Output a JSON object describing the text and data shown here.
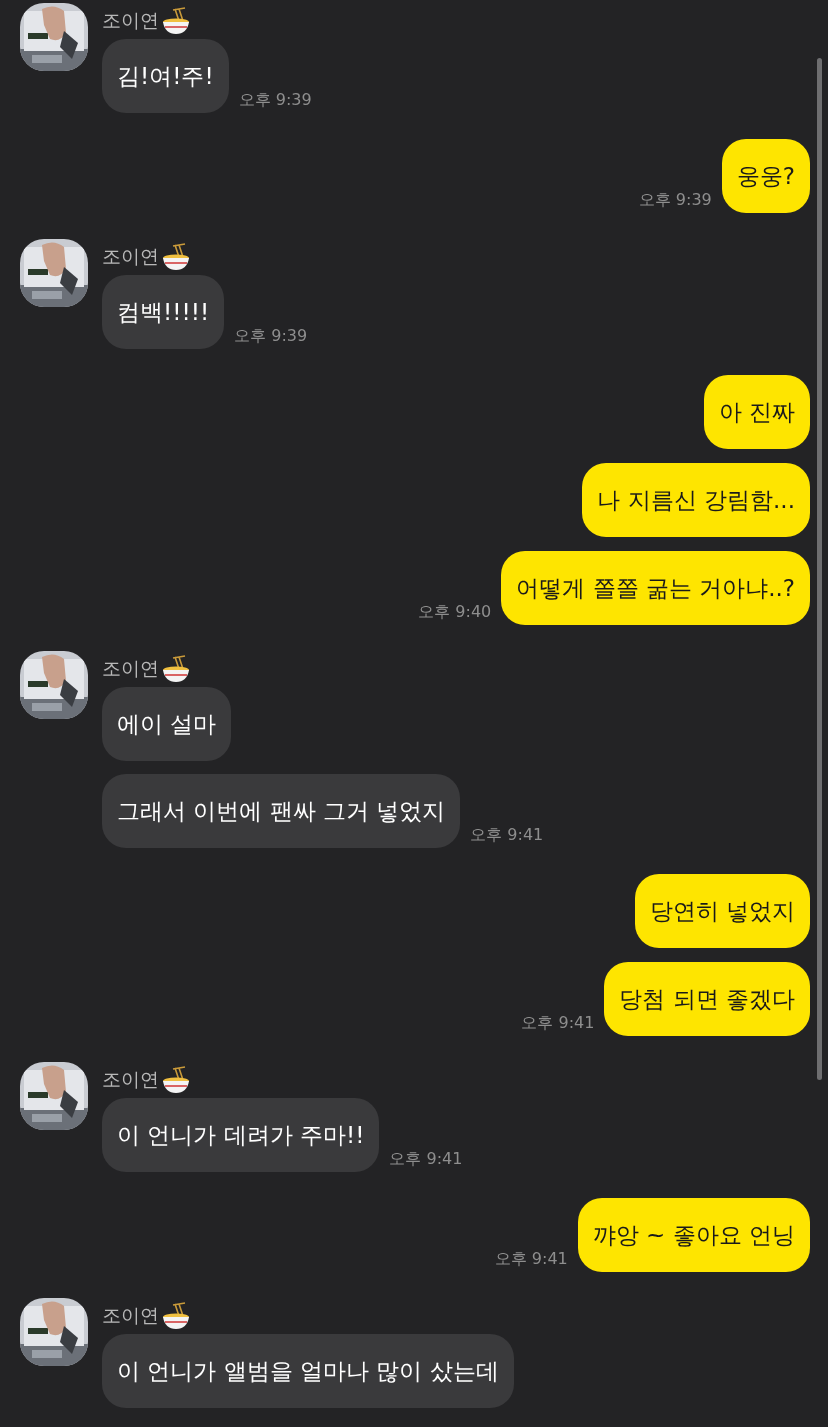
{
  "groups": [
    {
      "kind": "received",
      "sender": "조이연",
      "messages": [
        {
          "text": "김!여!주!",
          "time": "오후 9:39"
        }
      ]
    },
    {
      "kind": "sent",
      "messages": [
        {
          "text": "웅웅?",
          "time": "오후 9:39"
        }
      ]
    },
    {
      "kind": "received",
      "sender": "조이연",
      "messages": [
        {
          "text": "컴백!!!!!",
          "time": "오후 9:39"
        }
      ]
    },
    {
      "kind": "sent",
      "messages": [
        {
          "text": "아 진짜"
        },
        {
          "text": "나 지름신 강림함..."
        },
        {
          "text": "어떻게 쫄쫄 굶는 거아냐..?",
          "time": "오후 9:40"
        }
      ]
    },
    {
      "kind": "received",
      "sender": "조이연",
      "messages": [
        {
          "text": "에이 설마"
        },
        {
          "text": "그래서 이번에 팬싸 그거 넣었지",
          "time": "오후 9:41"
        }
      ]
    },
    {
      "kind": "sent",
      "messages": [
        {
          "text": "당연히 넣었지"
        },
        {
          "text": "당첨 되면 좋겠다",
          "time": "오후 9:41"
        }
      ]
    },
    {
      "kind": "received",
      "sender": "조이연",
      "messages": [
        {
          "text": "이 언니가 데려가 주마!!",
          "time": "오후 9:41"
        }
      ]
    },
    {
      "kind": "sent",
      "messages": [
        {
          "text": "꺄앙 ~ 좋아요 언닝",
          "time": "오후 9:41"
        }
      ]
    },
    {
      "kind": "received",
      "sender": "조이연",
      "messages": [
        {
          "text": "이 언니가 앨범을 얼마나 많이 샀는데"
        }
      ]
    }
  ]
}
